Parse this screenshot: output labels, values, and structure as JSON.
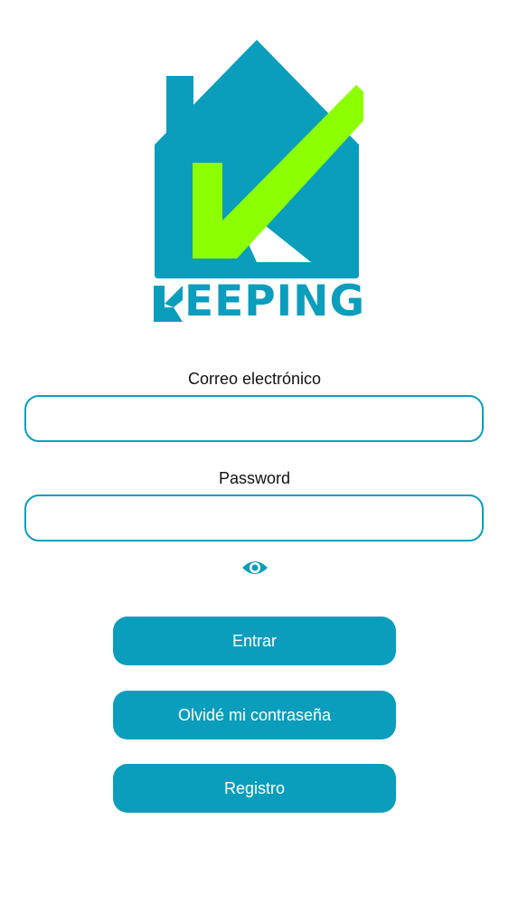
{
  "brand": {
    "wordmark_rest": "EEPING",
    "primary_color": "#0b9dbc",
    "accent_color": "#8cff00"
  },
  "form": {
    "email_label": "Correo electrónico",
    "email_value": "",
    "password_label": "Password",
    "password_value": "",
    "password_toggle_icon": "eye-icon"
  },
  "actions": {
    "login_label": "Entrar",
    "forgot_label": "Olvidé mi contraseña",
    "register_label": "Registro"
  }
}
